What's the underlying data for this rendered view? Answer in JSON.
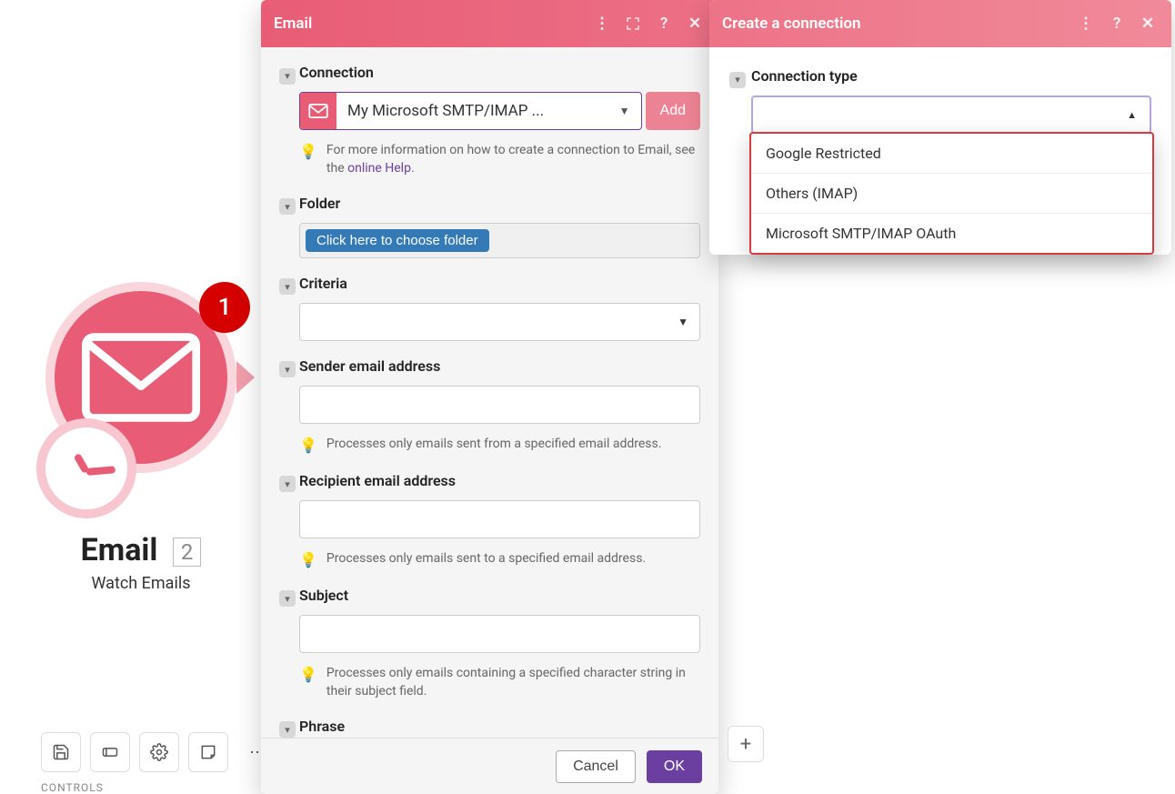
{
  "module": {
    "badge": "1",
    "title": "Email",
    "count": "2",
    "subtitle": "Watch Emails"
  },
  "toolbar": {
    "label": "CONTROLS"
  },
  "emailPanel": {
    "title": "Email",
    "fields": {
      "connection": {
        "label": "Connection",
        "selected": "My Microsoft SMTP/IMAP ...",
        "addLabel": "Add",
        "hintPrefix": "For more information on how to create a connection to Email, see the ",
        "hintLink": "online Help",
        "hintSuffix": "."
      },
      "folder": {
        "label": "Folder",
        "button": "Click here to choose folder"
      },
      "criteria": {
        "label": "Criteria"
      },
      "sender": {
        "label": "Sender email address",
        "hint": "Processes only emails sent from a specified email address."
      },
      "recipient": {
        "label": "Recipient email address",
        "hint": "Processes only emails sent to a specified email address."
      },
      "subject": {
        "label": "Subject",
        "hint": "Processes only emails containing a specified character string in their subject field."
      },
      "phrase": {
        "label": "Phrase"
      }
    },
    "footer": {
      "cancel": "Cancel",
      "ok": "OK"
    }
  },
  "connPanel": {
    "title": "Create a connection",
    "typeLabel": "Connection type",
    "options": [
      "Google Restricted",
      "Others (IMAP)",
      "Microsoft SMTP/IMAP OAuth"
    ]
  }
}
